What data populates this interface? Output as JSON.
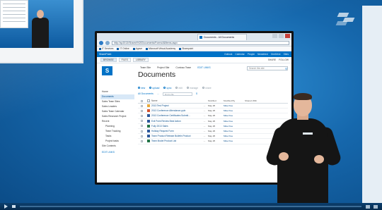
{
  "browser": {
    "tab_title": "Documents - All Documents",
    "address": "http://sp2013/Shared%20Documents/Forms/AllItems.aspx",
    "favorites": [
      {
        "label": "IT Services"
      },
      {
        "label": "IT Online"
      },
      {
        "label": "Agave"
      },
      {
        "label": "Microsoft Virtual Academy"
      },
      {
        "label": "Sharepoint"
      }
    ]
  },
  "suite_bar": {
    "brand": "SharePoint",
    "links": [
      "Outlook",
      "Calendar",
      "People",
      "Newsfeed",
      "OneDrive",
      "Sites"
    ]
  },
  "ribbon": {
    "tabs": [
      "BROWSE",
      "FILES",
      "LIBRARY"
    ],
    "actions": [
      "SHARE",
      "FOLLOW"
    ]
  },
  "site": {
    "logo_letter": "S",
    "top_links": [
      "Team Site",
      "Project Site",
      "Contoso Team",
      "EDIT LINKS"
    ],
    "title": "Documents",
    "search_placeholder": "Search this site"
  },
  "quick_launch": [
    {
      "label": "Home",
      "level": 0
    },
    {
      "label": "Documents",
      "level": 0,
      "selected": true
    },
    {
      "label": "Sales Team Sites",
      "level": 0
    },
    {
      "label": "Sales Leaders",
      "level": 0
    },
    {
      "label": "Sales Team Calendar",
      "level": 0
    },
    {
      "label": "Sales Research Project",
      "level": 0
    },
    {
      "label": "Recent",
      "level": 0
    },
    {
      "label": "Planning",
      "level": 1
    },
    {
      "label": "Team Tracking",
      "level": 1
    },
    {
      "label": "Tasks",
      "level": 1
    },
    {
      "label": "Project tasks",
      "level": 1
    },
    {
      "label": "Site Contents",
      "level": 0
    },
    {
      "label": "EDIT LINKS",
      "level": 0,
      "edit": true
    }
  ],
  "commands": [
    {
      "label": "new",
      "enabled": true
    },
    {
      "label": "upload",
      "enabled": true
    },
    {
      "label": "sync",
      "enabled": true
    },
    {
      "label": "edit",
      "enabled": false
    },
    {
      "label": "manage",
      "enabled": false
    },
    {
      "label": "share",
      "enabled": false
    }
  ],
  "views": {
    "current": "All Documents",
    "more": "...",
    "find_placeholder": "Find a file"
  },
  "table": {
    "headers": {
      "name": "Name",
      "modified": "Modified",
      "modified_by": "Modified By",
      "shared_with": "Shared With"
    },
    "rows": [
      {
        "name": "2013 Test Project",
        "icon_color": "#e8a93a",
        "modified": "May 25",
        "by": "Mike Pea",
        "shared": ""
      },
      {
        "name": "2013 Conference Attendance.pptx",
        "icon_color": "#d2522f",
        "modified": "May 25",
        "by": "Mike Pea",
        "shared": ""
      },
      {
        "name": "2013 Conference Certificates Submit...",
        "icon_color": "#2b579a",
        "modified": "May 25",
        "by": "Mike Pea",
        "shared": ""
      },
      {
        "name": "Exit Point Review Best Action",
        "icon_color": "#2b579a",
        "modified": "May 25",
        "by": "Mike Pea",
        "shared": ""
      },
      {
        "name": "Fully 2013 Sales",
        "icon_color": "#217346",
        "modified": "May 25",
        "by": "Mike Pea",
        "shared": ""
      },
      {
        "name": "Holiday Request Form",
        "icon_color": "#2b579a",
        "modified": "May 25",
        "by": "Mike Pea",
        "shared": ""
      },
      {
        "name": "Team Product Release Bulletin Product",
        "icon_color": "#2b579a",
        "modified": "May 25",
        "by": "Mike Pea",
        "shared": ""
      },
      {
        "name": "Team Model Product List",
        "icon_color": "#217346",
        "modified": "May 25",
        "by": "Mike Pea",
        "shared": ""
      }
    ]
  },
  "colors": {
    "sharepoint_blue": "#0072c6",
    "stage_blue": "#1668ad"
  }
}
